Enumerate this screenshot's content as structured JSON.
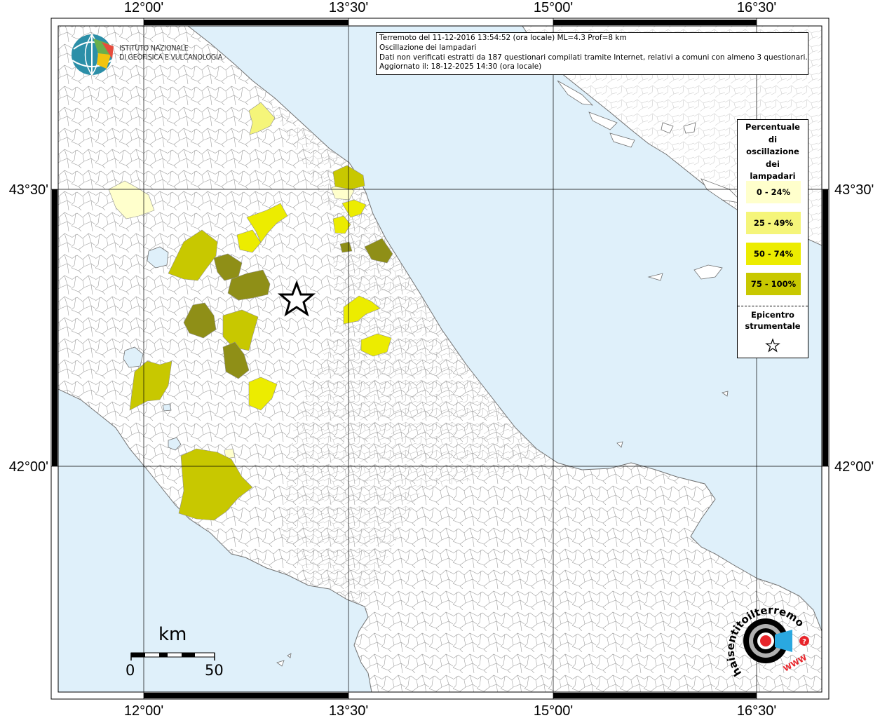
{
  "map": {
    "lon_labels": [
      "12°00'",
      "13°30'",
      "15°00'",
      "16°30'"
    ],
    "lat_labels": [
      "43°30'",
      "42°00'"
    ],
    "colors": {
      "sea": "#dff0fa",
      "land": "#ffffff",
      "borders": "#8f8f8f",
      "class_0_24": "#ffffcc",
      "class_25_49": "#f5f57a",
      "class_50_74": "#ecec00",
      "class_75_100": "#c8c800",
      "class_dark": "#8f8f17"
    }
  },
  "logo": {
    "line1": "ISTITUTO NAZIONALE",
    "line2": "DI GEOFISICA E VULCANOLOGIA"
  },
  "info": {
    "line1": "Terremoto del 11-12-2016 13:54:52 (ora locale) ML=4.3 Prof=8 km",
    "line2": "Oscillazione dei lampadari",
    "line3": "Dati non verificati estratti da 187 questionari compilati tramite Internet, relativi a comuni con almeno 3 questionari.",
    "line4": "Aggiornato il: 18-12-2025 14:30 (ora locale)"
  },
  "legend": {
    "title": "Percentuale\ndi\noscillazione\ndei\nlampadari",
    "items": [
      {
        "label": "0 - 24%",
        "color": "#ffffcc"
      },
      {
        "label": "25 - 49%",
        "color": "#f5f57a"
      },
      {
        "label": "50 - 74%",
        "color": "#ecec00"
      },
      {
        "label": "75 - 100%",
        "color": "#c8c800"
      }
    ],
    "epicenter": "Epicentro\nstrumentale"
  },
  "scale": {
    "unit": "km",
    "min": "0",
    "max": "50"
  },
  "site_logo": {
    "text": "haisentitoilterremoto.it",
    "www": "WWW"
  }
}
